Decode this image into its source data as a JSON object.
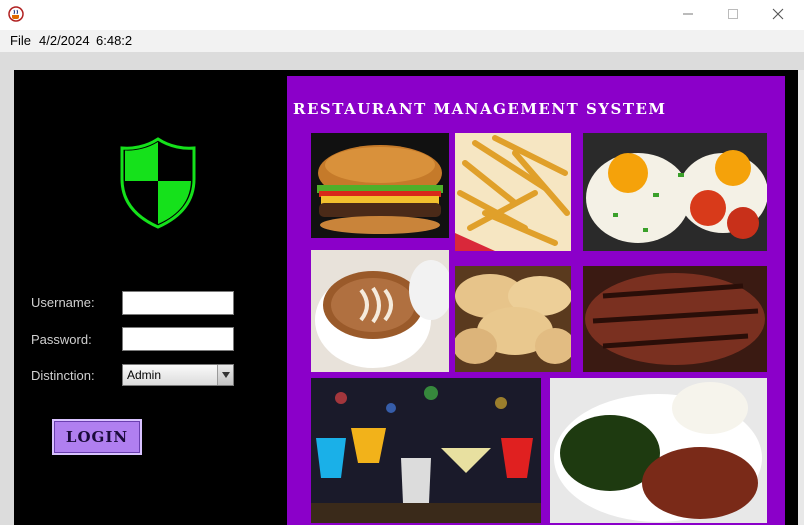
{
  "window": {
    "app_icon": "java-coffee-icon",
    "controls": {
      "minimize": "minimize-icon",
      "maximize": "maximize-icon",
      "close": "close-icon"
    }
  },
  "menubar": {
    "file_label": "File",
    "date": "4/2/2024",
    "time": "6:48:2"
  },
  "login": {
    "shield_icon": "security-shield-icon",
    "username_label": "Username:",
    "username_value": "",
    "password_label": "Password:",
    "password_value": "",
    "distinction_label": "Distinction:",
    "distinction_value": "Admin",
    "login_button": "LOGIN"
  },
  "panel": {
    "title": "RESTAURANT MANAGEMENT SYSTEM",
    "images": [
      "burger",
      "french-fries",
      "fried-eggs",
      "latte-coffee",
      "bread-rolls",
      "grilled-steak",
      "cocktails",
      "rice-greens-and-meat"
    ]
  },
  "colors": {
    "panel_bg": "#8b00c9",
    "shield_green": "#15e11b",
    "login_button_bg": "#b07ff0",
    "background": "#000000"
  }
}
